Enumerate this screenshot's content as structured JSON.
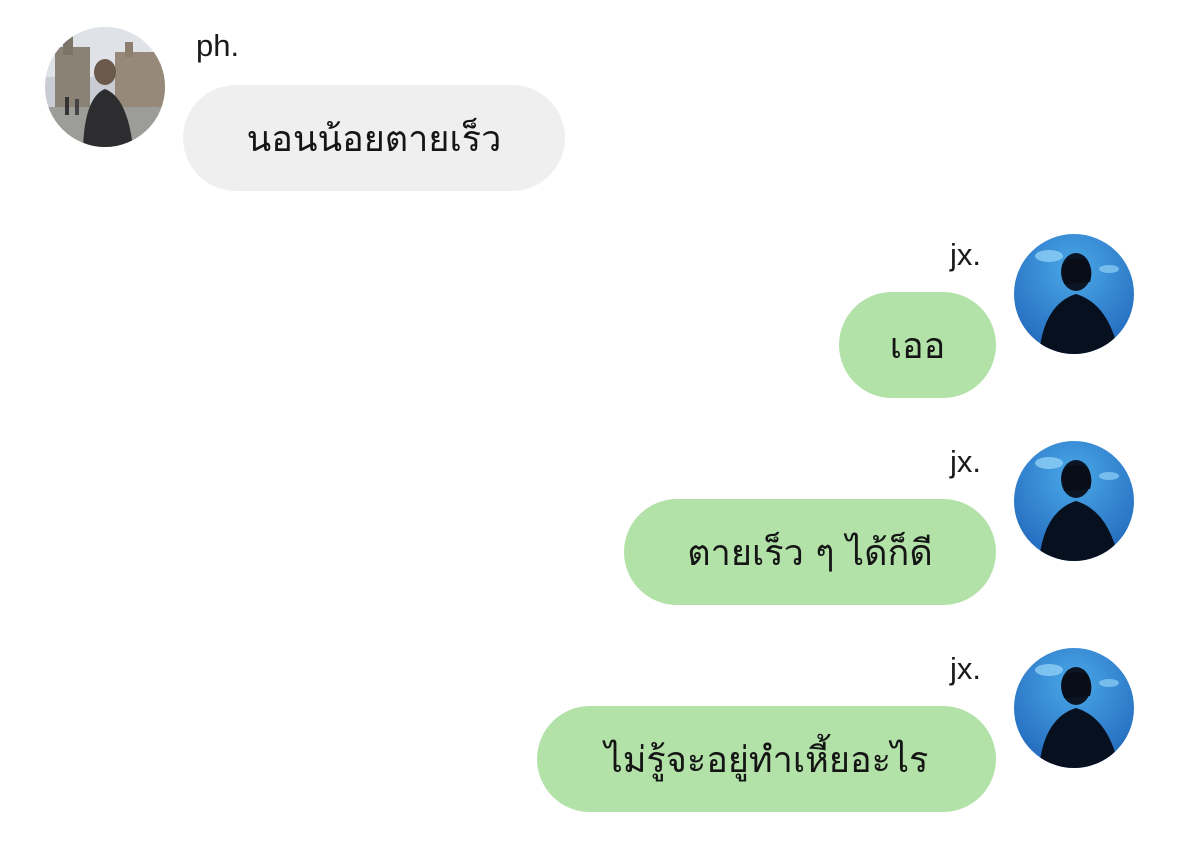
{
  "chat": {
    "messages": [
      {
        "sender": "ph.",
        "direction": "incoming",
        "text": "นอนน้อยตายเร็ว",
        "avatar": "avatar-photo-ph"
      },
      {
        "sender": "jx.",
        "direction": "outgoing",
        "text": "เออ",
        "avatar": "avatar-photo-jx"
      },
      {
        "sender": "jx.",
        "direction": "outgoing",
        "text": "ตายเร็ว ๆ ได้ก็ดี",
        "avatar": "avatar-photo-jx"
      },
      {
        "sender": "jx.",
        "direction": "outgoing",
        "text": "ไม่รู้จะอยู่ทำเหี้ยอะไร",
        "avatar": "avatar-photo-jx"
      }
    ]
  },
  "colors": {
    "incoming_bubble": "#efefef",
    "outgoing_bubble": "#b2e2a8",
    "background": "#ffffff"
  }
}
